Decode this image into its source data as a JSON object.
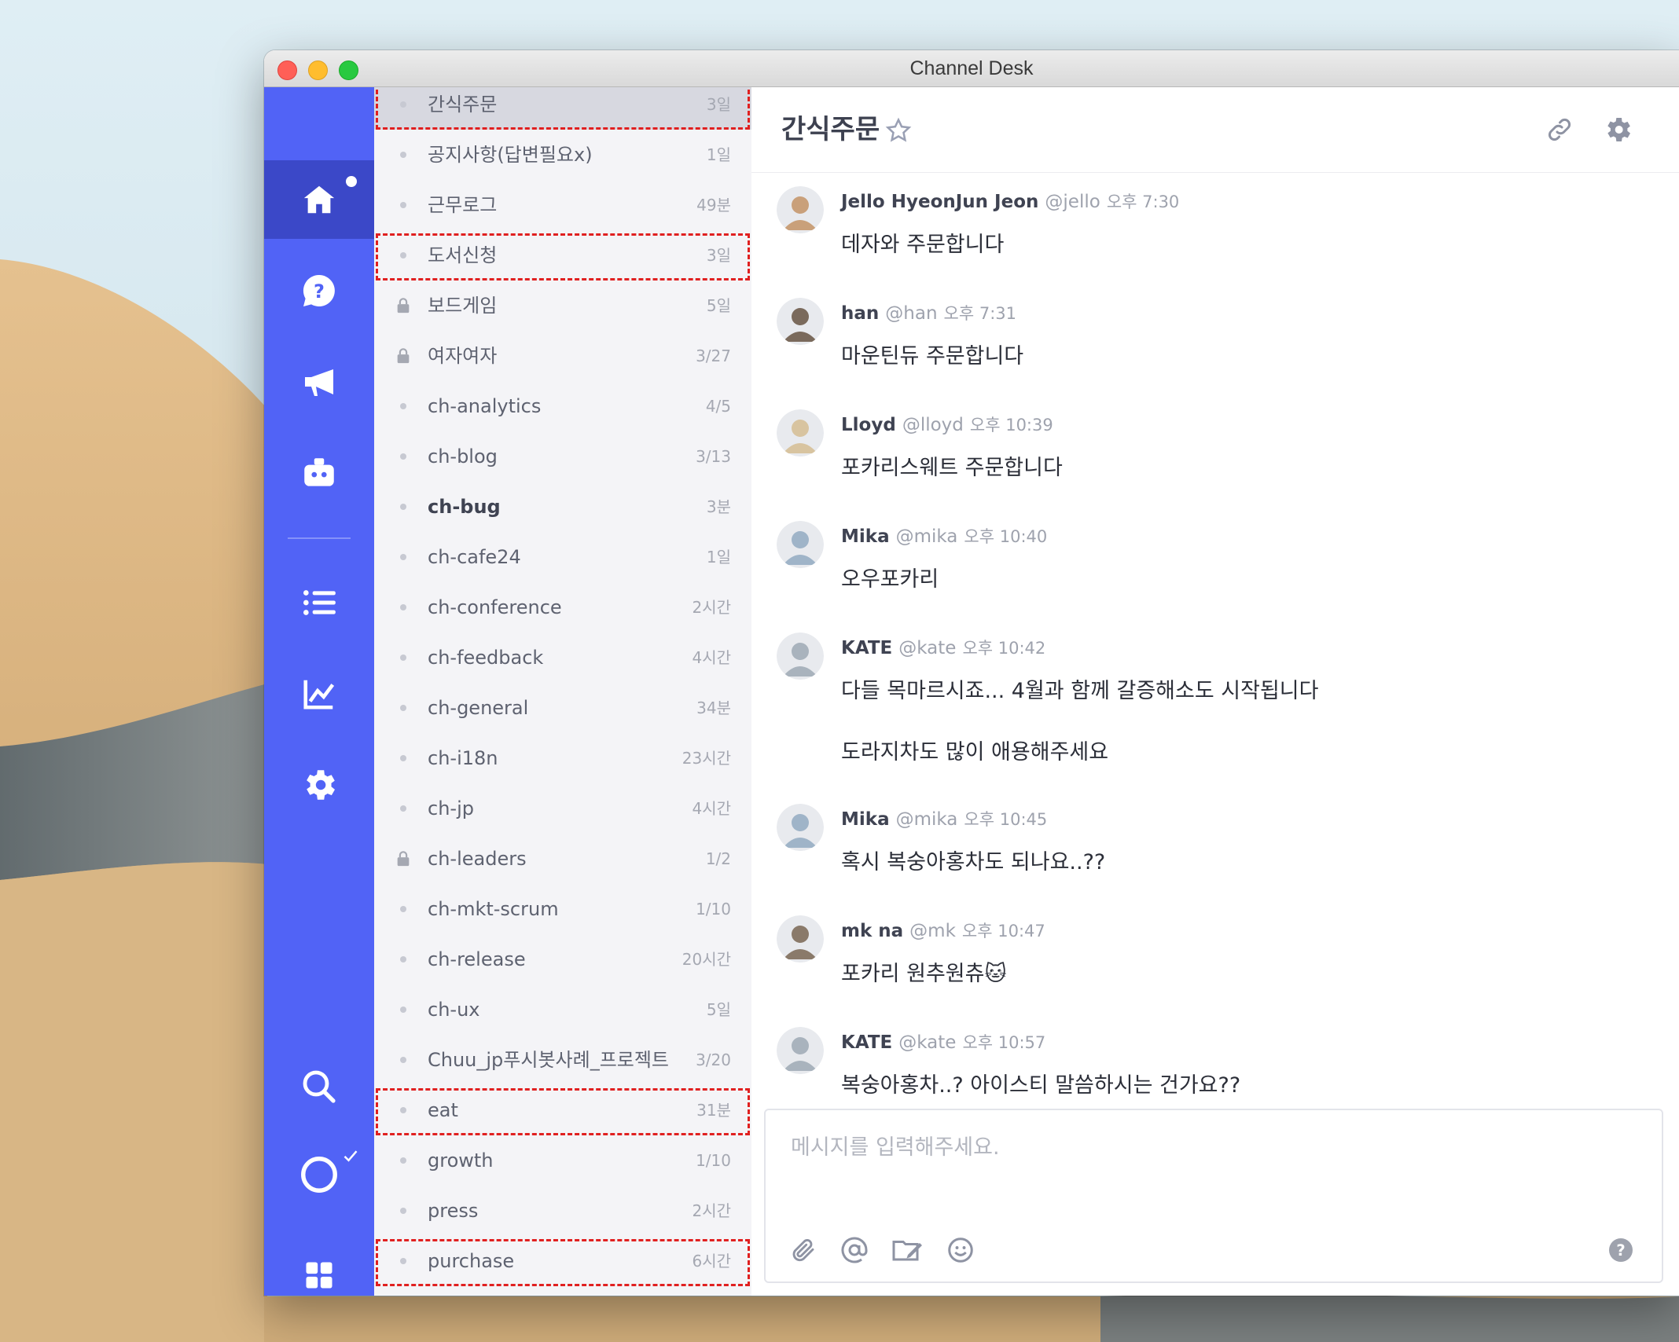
{
  "window": {
    "title": "Channel Desk"
  },
  "rail": {
    "items": [
      {
        "icon": "home-icon",
        "active": true,
        "badge": true
      },
      {
        "icon": "help-bubble-icon"
      },
      {
        "icon": "megaphone-icon"
      },
      {
        "icon": "bot-icon"
      },
      {
        "icon": "list-icon"
      },
      {
        "icon": "chart-icon"
      },
      {
        "icon": "gear-icon"
      },
      {
        "icon": "search-icon"
      },
      {
        "icon": "status-circle-icon"
      },
      {
        "icon": "apps-grid-icon"
      }
    ]
  },
  "channels": [
    {
      "name": "간식주문",
      "time": "3일",
      "selected": true,
      "locked": false,
      "bold": false,
      "highlight": true
    },
    {
      "name": "공지사항(답변필요x)",
      "time": "1일"
    },
    {
      "name": "근무로그",
      "time": "49분"
    },
    {
      "name": "도서신청",
      "time": "3일",
      "highlight": true
    },
    {
      "name": "보드게임",
      "time": "5일",
      "locked": true
    },
    {
      "name": "여자여자",
      "time": "3/27",
      "locked": true
    },
    {
      "name": "ch-analytics",
      "time": "4/5"
    },
    {
      "name": "ch-blog",
      "time": "3/13"
    },
    {
      "name": "ch-bug",
      "time": "3분",
      "bold": true
    },
    {
      "name": "ch-cafe24",
      "time": "1일"
    },
    {
      "name": "ch-conference",
      "time": "2시간"
    },
    {
      "name": "ch-feedback",
      "time": "4시간"
    },
    {
      "name": "ch-general",
      "time": "34분"
    },
    {
      "name": "ch-i18n",
      "time": "23시간"
    },
    {
      "name": "ch-jp",
      "time": "4시간"
    },
    {
      "name": "ch-leaders",
      "time": "1/2",
      "locked": true
    },
    {
      "name": "ch-mkt-scrum",
      "time": "1/10"
    },
    {
      "name": "ch-release",
      "time": "20시간"
    },
    {
      "name": "ch-ux",
      "time": "5일"
    },
    {
      "name": "Chuu_jp푸시봇사례_프로젝트",
      "time": "3/20"
    },
    {
      "name": "eat",
      "time": "31분",
      "highlight": true
    },
    {
      "name": "growth",
      "time": "1/10"
    },
    {
      "name": "press",
      "time": "2시간"
    },
    {
      "name": "purchase",
      "time": "6시간",
      "highlight": true
    }
  ],
  "chat": {
    "title": "간식주문",
    "messages": [
      {
        "user": "Jello HyeonJun Jeon",
        "handle": "@jello",
        "time": "오후 7:30",
        "text": "데자와 주문합니다",
        "avatar_color": "#c9a07a"
      },
      {
        "user": "han",
        "handle": "@han",
        "time": "오후 7:31",
        "text": "마운틴듀 주문합니다",
        "avatar_color": "#7a6a5c"
      },
      {
        "user": "Lloyd",
        "handle": "@lloyd",
        "time": "오후 10:39",
        "text": "포카리스웨트 주문합니다",
        "avatar_color": "#d8c4a0"
      },
      {
        "user": "Mika",
        "handle": "@mika",
        "time": "오후 10:40",
        "text": "오우포카리",
        "avatar_color": "#9fb4c8"
      },
      {
        "user": "KATE",
        "handle": "@kate",
        "time": "오후 10:42",
        "text": "다들 목마르시죠... 4월과 함께 갈증해소도 시작됩니다",
        "text2": "도라지차도 많이 애용해주세요",
        "avatar_color": "#a9b3bd"
      },
      {
        "user": "Mika",
        "handle": "@mika",
        "time": "오후 10:45",
        "text": "혹시 복숭아홍차도 되나요..??",
        "avatar_color": "#9fb4c8"
      },
      {
        "user": "mk na",
        "handle": "@mk",
        "time": "오후 10:47",
        "text": "포카리 원추원츄🐱",
        "avatar_color": "#8a7a6a"
      },
      {
        "user": "KATE",
        "handle": "@kate",
        "time": "오후 10:57",
        "text": "복숭아홍차..? 아이스티 말씀하시는 건가요??",
        "avatar_color": "#a9b3bd"
      }
    ]
  },
  "composer": {
    "placeholder": "메시지를 입력해주세요.",
    "value": "",
    "tools": [
      "paperclip-icon",
      "mention-icon",
      "folder-icon",
      "emoji-icon",
      "help-icon"
    ]
  },
  "colors": {
    "rail": "#5163f6",
    "rail_active": "#3b48c8",
    "channel_bg": "#f4f4f7",
    "selected": "#d7d8e0",
    "highlight_border": "#e02020"
  }
}
